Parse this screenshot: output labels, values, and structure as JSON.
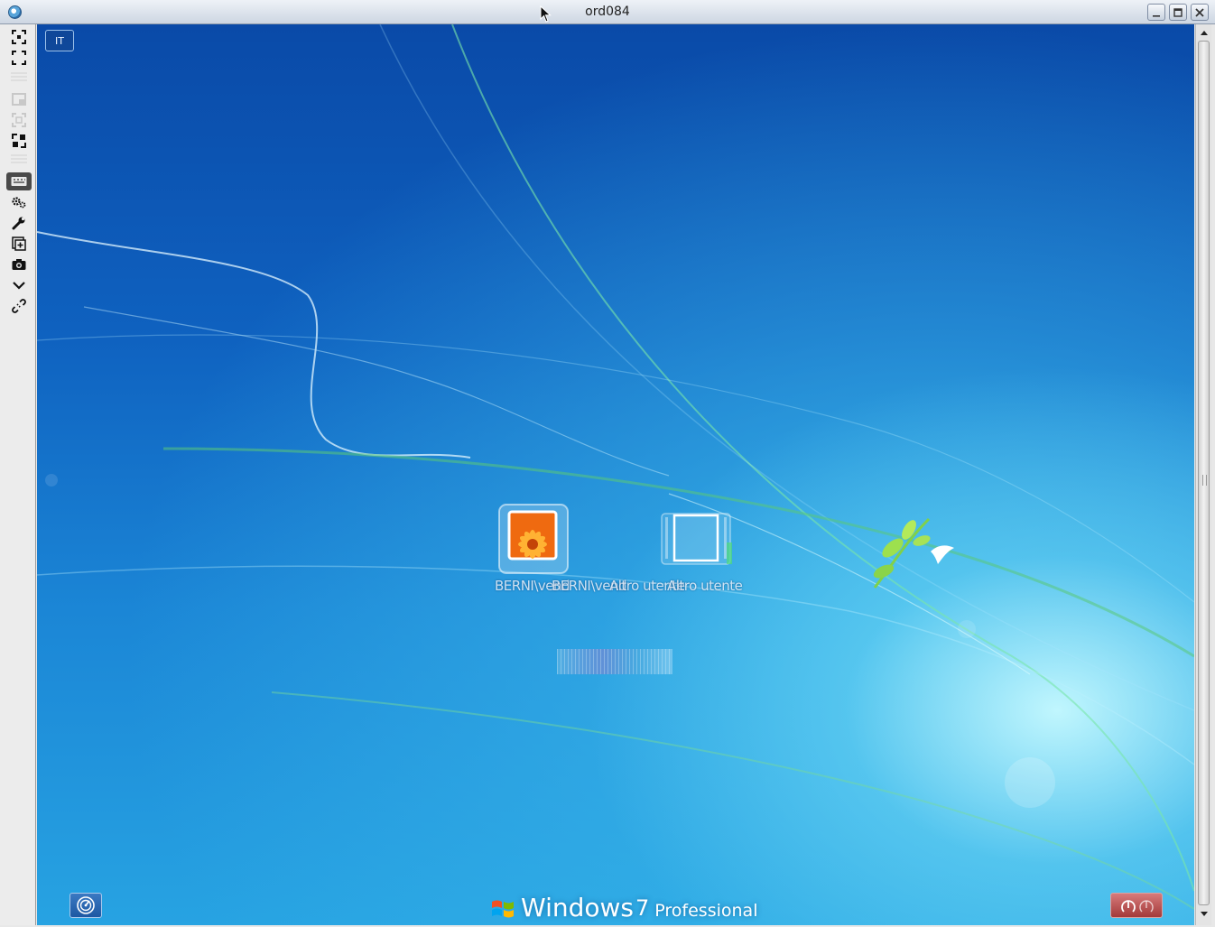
{
  "window": {
    "title": "ord084",
    "controls": [
      "minimize-icon",
      "maximize-icon",
      "close-icon"
    ]
  },
  "toolbar": {
    "items": [
      {
        "name": "fit-to-window-icon",
        "state": "enabled"
      },
      {
        "name": "fullscreen-icon",
        "state": "enabled"
      },
      {
        "name": "separator"
      },
      {
        "name": "scale-window-icon",
        "state": "disabled"
      },
      {
        "name": "actual-size-icon",
        "state": "disabled"
      },
      {
        "name": "zoom-icon",
        "state": "enabled"
      },
      {
        "name": "separator"
      },
      {
        "name": "keyboard-icon",
        "state": "active"
      },
      {
        "name": "settings-gears-icon",
        "state": "enabled"
      },
      {
        "name": "wrench-icon",
        "state": "enabled"
      },
      {
        "name": "new-connection-icon",
        "state": "enabled"
      },
      {
        "name": "camera-icon",
        "state": "enabled"
      },
      {
        "name": "chevron-down-icon",
        "state": "enabled"
      },
      {
        "name": "disconnect-icon",
        "state": "enabled"
      }
    ]
  },
  "desktop": {
    "language_indicator": "IT",
    "users": [
      {
        "name_lines": [
          "BERNI\\vend",
          "BERNI\\vend"
        ]
      },
      {
        "name_lines": [
          "Altro utente",
          "Altro utente"
        ]
      }
    ],
    "brand": {
      "product": "Windows",
      "version": "7",
      "edition": "Professional"
    }
  },
  "colors": {
    "desktop_top": "#0a4aa8",
    "desktop_glow": "#c8faff",
    "power_button": "#a33a3a"
  }
}
